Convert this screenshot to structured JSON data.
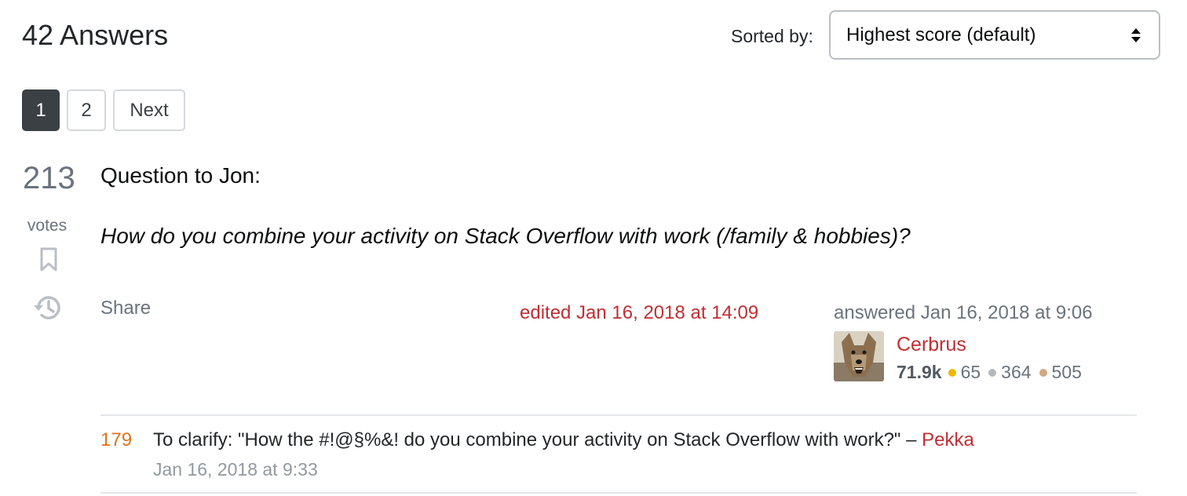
{
  "header": {
    "answers_title": "42 Answers",
    "sort_label": "Sorted by:",
    "sort_value": "Highest score (default)"
  },
  "pager": {
    "page1": "1",
    "page2": "2",
    "next": "Next"
  },
  "answer": {
    "votes": "213",
    "votes_label": "votes",
    "line1": "Question to Jon:",
    "line2": "How do you combine your activity on Stack Overflow with work (/family & hobbies)?",
    "share": "Share",
    "edited": "edited Jan 16, 2018 at 14:09",
    "answered": "answered Jan 16, 2018 at 9:06",
    "user": {
      "name": "Cerbrus",
      "reputation": "71.9k",
      "gold": "65",
      "silver": "364",
      "bronze": "505"
    }
  },
  "comment": {
    "score": "179",
    "text": "To clarify: \"How the #!@§%&! do you combine your activity on Stack Overflow with work?\"",
    "separator": "–",
    "user": "Pekka",
    "date": "Jan 16, 2018 at 9:33"
  },
  "colors": {
    "accent_red": "#c22e32",
    "comment_score": "#e0731a",
    "gold": "#f1b600",
    "silver": "#b4b8bc",
    "bronze": "#d1a684"
  },
  "icons": [
    "sort-arrows-icon",
    "bookmark-icon",
    "history-icon"
  ]
}
